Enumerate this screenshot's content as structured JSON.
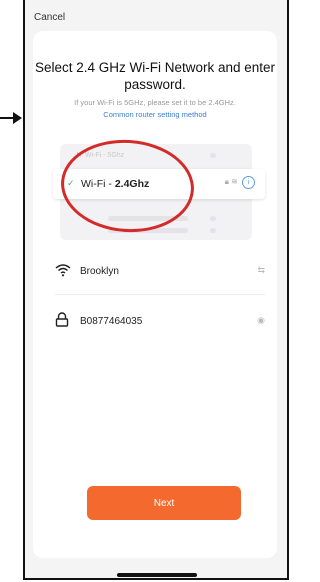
{
  "header": {
    "cancel_label": "Cancel"
  },
  "main": {
    "title": "Select 2.4 GHz Wi-Fi Network and enter password.",
    "subtitle": "If your Wi-Fi is 5GHz, please set it to be 2.4GHz.",
    "link_label": "Common router setting method",
    "illustration": {
      "bad_network": {
        "prefix": "Wi-Fi - ",
        "band": "5Ghz",
        "status_icon": "x-icon"
      },
      "good_network": {
        "prefix": "Wi-Fi - ",
        "band": "2.4Ghz",
        "status_icon": "check-icon"
      }
    },
    "network": {
      "ssid": "Brooklyn",
      "icon": "wifi-icon",
      "action_icon": "switch-network-icon"
    },
    "password": {
      "value": "B0877464035",
      "icon": "lock-icon",
      "action_icon": "eye-icon"
    },
    "next_label": "Next"
  },
  "colors": {
    "accent": "#f46a2e",
    "link": "#3a7fd5",
    "annotation": "#d32a2a",
    "check": "#4db06a",
    "error": "#e86a6a"
  }
}
